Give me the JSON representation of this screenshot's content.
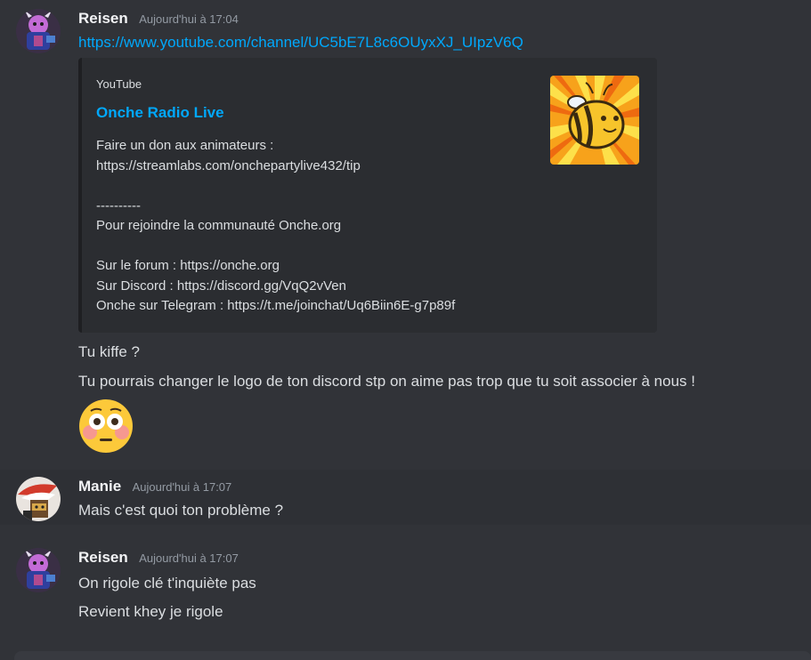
{
  "messages": [
    {
      "author": "Reisen",
      "timestamp": "Aujourd'hui à 17:04",
      "link": "https://www.youtube.com/channel/UC5bE7L8c6OUyxXJ_UIpzV6Q",
      "embed": {
        "provider": "YouTube",
        "title": "Onche Radio Live",
        "description": "Faire un don aux animateurs :\nhttps://streamlabs.com/onchepartylive432/tip\n\n----------\nPour rejoindre la communauté Onche.org\n\nSur le forum : https://onche.org\nSur Discord : https://discord.gg/VqQ2vVen\nOnche sur Telegram : https://t.me/joinchat/Uq6Biin6E-g7p89f"
      },
      "lines": [
        "Tu kiffe ?",
        "Tu pourrais changer le logo de ton discord stp on aime pas trop que tu soit associer à nous !"
      ],
      "emoji": "flushed-face"
    },
    {
      "author": "Manie",
      "timestamp": "Aujourd'hui à 17:07",
      "lines": [
        "Mais c'est quoi ton problème ?"
      ]
    },
    {
      "author": "Reisen",
      "timestamp": "Aujourd'hui à 17:07",
      "lines": [
        "On rigole clé t'inquiète pas",
        "Revient khey je rigole"
      ]
    }
  ],
  "colors": {
    "background": "#313338",
    "embed_background": "#2b2d31",
    "link": "#00a8fc",
    "timestamp": "#949ba4",
    "username": "#f2f3f5"
  }
}
